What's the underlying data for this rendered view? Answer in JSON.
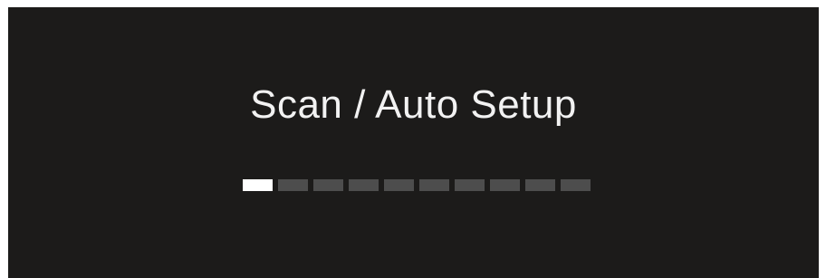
{
  "dialog": {
    "title": "Scan / Auto Setup"
  },
  "progress": {
    "total_segments": 10,
    "filled_segments": 1,
    "fraction": 0.1,
    "colors": {
      "filled": "#ffffff",
      "empty": "#4d4d4d",
      "background": "#1c1b1a"
    }
  }
}
